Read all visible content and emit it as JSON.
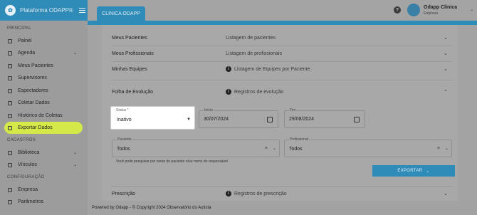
{
  "sidebar": {
    "brand": "Plataforma ODAPP®",
    "sections": {
      "principal": "PRINCIPAL",
      "cadastros": "CADASTROS",
      "configuracao": "CONFIGURAÇÃO"
    },
    "items": [
      {
        "label": "Painel",
        "icon": "dashboard-icon"
      },
      {
        "label": "Agenda",
        "icon": "calendar-icon",
        "expandable": true
      },
      {
        "label": "Meus Pacientes",
        "icon": "users-icon"
      },
      {
        "label": "Supervisores",
        "icon": "supervisor-icon"
      },
      {
        "label": "Espectadores",
        "icon": "eye-icon"
      },
      {
        "label": "Coletar Dados",
        "icon": "edit-icon"
      },
      {
        "label": "Histórico de Coletas",
        "icon": "history-icon"
      },
      {
        "label": "Exportar Dados",
        "icon": "export-icon",
        "active": true
      },
      {
        "label": "Biblioteca",
        "icon": "book-icon",
        "expandable": true
      },
      {
        "label": "Vínculos",
        "icon": "link-icon",
        "expandable": true
      },
      {
        "label": "Empresa",
        "icon": "building-icon"
      },
      {
        "label": "Parâmetros",
        "icon": "gear-icon"
      }
    ]
  },
  "topbar": {
    "tab": "CLINICA ODAPP",
    "user_name": "Odapp Clinica",
    "user_role": "Empresa"
  },
  "filters": {
    "rows": [
      {
        "label": "Meus Pacientes",
        "desc": "Listagem de pacientes"
      },
      {
        "label": "Meus Profissionais",
        "desc": "Listagem de profissionais"
      },
      {
        "label": "Minhas Equipes",
        "desc": "Listagem de Equipes por Paciente"
      },
      {
        "label": "Folha de Evolução",
        "desc": "Registros de evolução"
      }
    ],
    "status_label": "Status *",
    "status_value": "Inativo",
    "inicio_label": "Início",
    "inicio_value": "30/07/2024",
    "fim_label": "Fim",
    "fim_value": "29/08/2024",
    "paciente_label": "Paciente",
    "paciente_value": "Todos",
    "profissional_label": "Profissional",
    "profissional_value": "Todos",
    "hint": "Você pode pesquisar por nome do paciente e/ou nome do responsável",
    "export_label": "EXPORTAR",
    "prescricao_label": "Prescrição",
    "prescricao_desc": "Registros de prescrição"
  },
  "footer": {
    "text": "Powered by Odapp - © Copyright 2024 Observatório do Autista"
  },
  "colors": {
    "accent": "#2f8bb8",
    "active_item": "#d4e84a"
  }
}
